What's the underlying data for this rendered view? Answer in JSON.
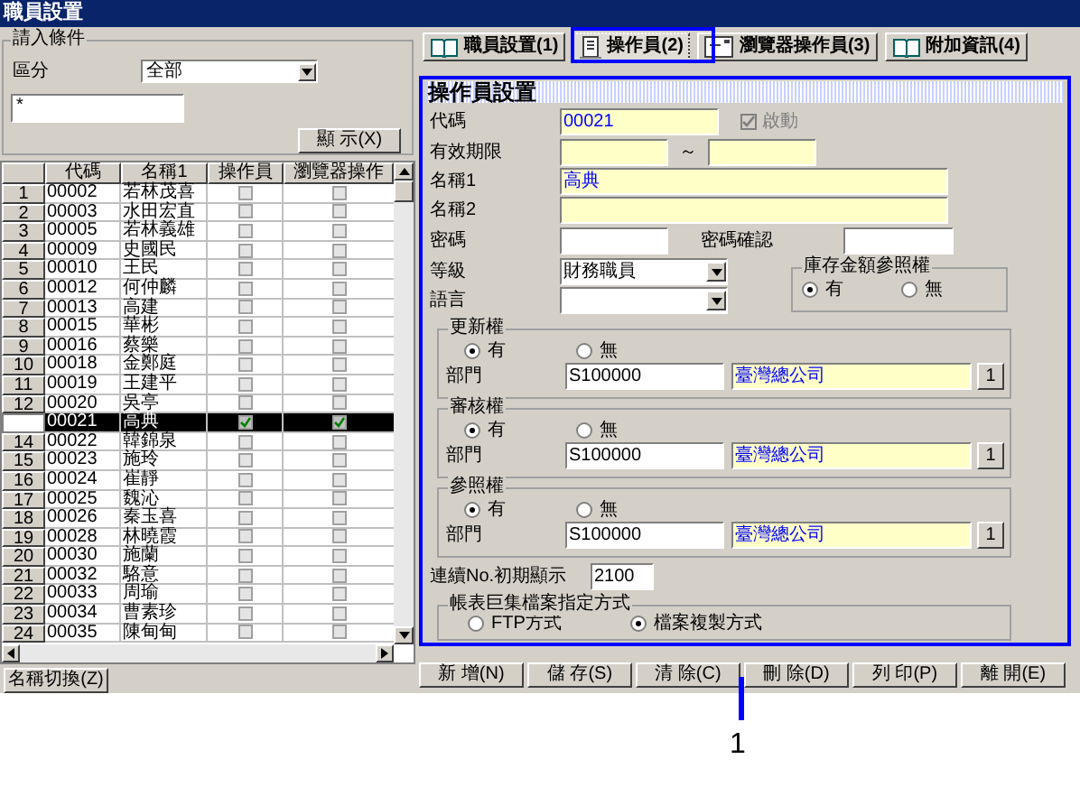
{
  "window": {
    "title": "職員設置"
  },
  "filter": {
    "title": "請入條件",
    "category_label": "區分",
    "category_value": "全部",
    "search_value": "*",
    "show_button": "顯 示(X)"
  },
  "grid": {
    "columns": [
      "代碼",
      "名稱1",
      "操作員",
      "瀏覽器操作"
    ],
    "rows": [
      {
        "no": "1",
        "code": "00002",
        "name": "若林茂喜",
        "operator": false,
        "browser_operator": false,
        "selected": false
      },
      {
        "no": "2",
        "code": "00003",
        "name": "水田宏直",
        "operator": false,
        "browser_operator": false,
        "selected": false
      },
      {
        "no": "3",
        "code": "00005",
        "name": "若林義雄",
        "operator": false,
        "browser_operator": false,
        "selected": false
      },
      {
        "no": "4",
        "code": "00009",
        "name": "史國民",
        "operator": false,
        "browser_operator": false,
        "selected": false
      },
      {
        "no": "5",
        "code": "00010",
        "name": "王民",
        "operator": false,
        "browser_operator": false,
        "selected": false
      },
      {
        "no": "6",
        "code": "00012",
        "name": "何仲麟",
        "operator": false,
        "browser_operator": false,
        "selected": false
      },
      {
        "no": "7",
        "code": "00013",
        "name": "高建",
        "operator": false,
        "browser_operator": false,
        "selected": false
      },
      {
        "no": "8",
        "code": "00015",
        "name": "華彬",
        "operator": false,
        "browser_operator": false,
        "selected": false
      },
      {
        "no": "9",
        "code": "00016",
        "name": "蔡樂",
        "operator": false,
        "browser_operator": false,
        "selected": false
      },
      {
        "no": "10",
        "code": "00018",
        "name": "金鄭庭",
        "operator": false,
        "browser_operator": false,
        "selected": false
      },
      {
        "no": "11",
        "code": "00019",
        "name": "王建平",
        "operator": false,
        "browser_operator": false,
        "selected": false
      },
      {
        "no": "12",
        "code": "00020",
        "name": "吳亭",
        "operator": false,
        "browser_operator": false,
        "selected": false
      },
      {
        "code": "00021",
        "name": "高典",
        "operator": true,
        "browser_operator": true,
        "selected": true
      },
      {
        "no": "14",
        "code": "00022",
        "name": "韓錦泉",
        "operator": false,
        "browser_operator": false,
        "selected": false
      },
      {
        "no": "15",
        "code": "00023",
        "name": "施玲",
        "operator": false,
        "browser_operator": false,
        "selected": false
      },
      {
        "no": "16",
        "code": "00024",
        "name": "崔靜",
        "operator": false,
        "browser_operator": false,
        "selected": false
      },
      {
        "no": "17",
        "code": "00025",
        "name": "魏沁",
        "operator": false,
        "browser_operator": false,
        "selected": false
      },
      {
        "no": "18",
        "code": "00026",
        "name": "秦玉喜",
        "operator": false,
        "browser_operator": false,
        "selected": false
      },
      {
        "no": "19",
        "code": "00028",
        "name": "林曉霞",
        "operator": false,
        "browser_operator": false,
        "selected": false
      },
      {
        "no": "20",
        "code": "00030",
        "name": "施蘭",
        "operator": false,
        "browser_operator": false,
        "selected": false
      },
      {
        "no": "21",
        "code": "00032",
        "name": "駱意",
        "operator": false,
        "browser_operator": false,
        "selected": false
      },
      {
        "no": "22",
        "code": "00033",
        "name": "周瑜",
        "operator": false,
        "browser_operator": false,
        "selected": false
      },
      {
        "no": "23",
        "code": "00034",
        "name": "曹素珍",
        "operator": false,
        "browser_operator": false,
        "selected": false
      },
      {
        "no": "24",
        "code": "00035",
        "name": "陳甸甸",
        "operator": false,
        "browser_operator": false,
        "selected": false
      }
    ]
  },
  "name_switch_button": "名稱切換(Z)",
  "tabs": [
    {
      "label": "職員設置(1)",
      "kind": "book",
      "selected": false
    },
    {
      "label": "操作員(2)",
      "kind": "document",
      "selected": true
    },
    {
      "label": "瀏覽器操作員(3)",
      "kind": "window",
      "selected": false
    },
    {
      "label": "附加資訊(4)",
      "kind": "book",
      "selected": false
    }
  ],
  "panel": {
    "title": "操作員設置",
    "code": {
      "label": "代碼",
      "value": "00021"
    },
    "enabled": {
      "label": "啟動",
      "checked": true,
      "disabled": true
    },
    "validity": {
      "label": "有效期限",
      "separator": "～"
    },
    "name1": {
      "label": "名稱1",
      "value": "高典"
    },
    "name2": {
      "label": "名稱2"
    },
    "password": {
      "label": "密碼"
    },
    "password_confirm": {
      "label": "密碼確認"
    },
    "level": {
      "label": "等級",
      "value": "財務職員"
    },
    "language": {
      "label": "語言"
    },
    "inventory_access": {
      "title": "庫存金額參照權",
      "options": [
        {
          "label": "有",
          "selected": true
        },
        {
          "label": "無",
          "selected": false
        }
      ]
    },
    "permissions": [
      {
        "title": "更新權",
        "options": [
          {
            "label": "有",
            "selected": true
          },
          {
            "label": "無",
            "selected": false
          }
        ],
        "dept_label": "部門",
        "dept_code": "S100000",
        "dept_name": "臺灣總公司",
        "lookup_button": "1"
      },
      {
        "title": "審核權",
        "options": [
          {
            "label": "有",
            "selected": true
          },
          {
            "label": "無",
            "selected": false
          }
        ],
        "dept_label": "部門",
        "dept_code": "S100000",
        "dept_name": "臺灣總公司",
        "lookup_button": "1"
      },
      {
        "title": "參照權",
        "options": [
          {
            "label": "有",
            "selected": true
          },
          {
            "label": "無",
            "selected": false
          }
        ],
        "dept_label": "部門",
        "dept_code": "S100000",
        "dept_name": "臺灣總公司",
        "lookup_button": "1"
      }
    ],
    "serial": {
      "label": "連續No.初期顯示",
      "value": "2100"
    },
    "macro": {
      "title": "帳表巨集檔案指定方式",
      "options": [
        {
          "label": "FTP方式",
          "selected": false
        },
        {
          "label": "檔案複製方式",
          "selected": true
        }
      ]
    }
  },
  "buttons": [
    "新 增(N)",
    "儲 存(S)",
    "清 除(C)",
    "刪 除(D)",
    "列 印(P)",
    "離 開(E)"
  ],
  "callout": {
    "label": "1"
  }
}
